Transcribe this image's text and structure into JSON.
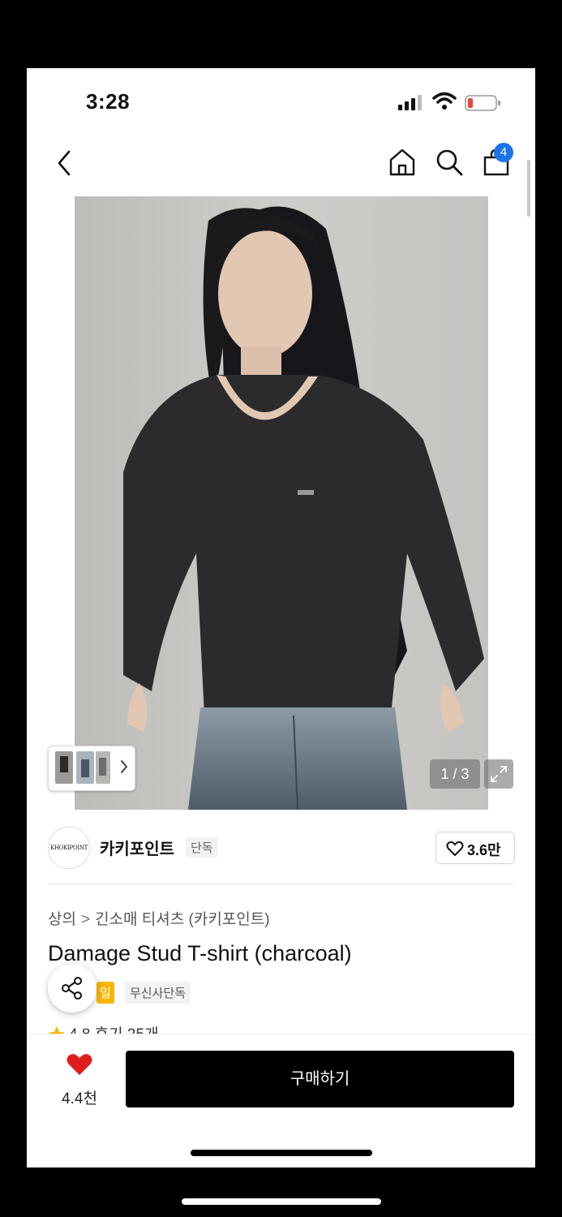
{
  "status": {
    "time": "3:28"
  },
  "nav": {
    "cart_count": "4"
  },
  "image": {
    "counter": "1 / 3",
    "current": 1,
    "total": 3
  },
  "brand": {
    "logo_text": "KHOKIPOINT",
    "name": "카키포인트",
    "tag": "단독",
    "likes": "3.6만"
  },
  "breadcrumb": {
    "level1": "상의",
    "separator": ">",
    "level2": "긴소매 티셔츠 (카키포인트)"
  },
  "product": {
    "title": "Damage Stud T-shirt (charcoal)",
    "sale_tag_partial": "일",
    "exclusive_tag": "무신사단독",
    "rating_partial": "4.8  후기 25개"
  },
  "bottom": {
    "wish_count": "4.4천",
    "buy_label": "구매하기"
  },
  "colors": {
    "accent_blue": "#1a73e8",
    "heart_red": "#e01d1d",
    "sale_yellow": "#f7b500",
    "battery_red": "#e5483f"
  },
  "icons": [
    "back-icon",
    "home-icon",
    "search-icon",
    "cart-icon",
    "expand-icon",
    "heart-outline-icon",
    "share-icon",
    "star-icon",
    "heart-filled-icon",
    "chevron-right-icon"
  ]
}
